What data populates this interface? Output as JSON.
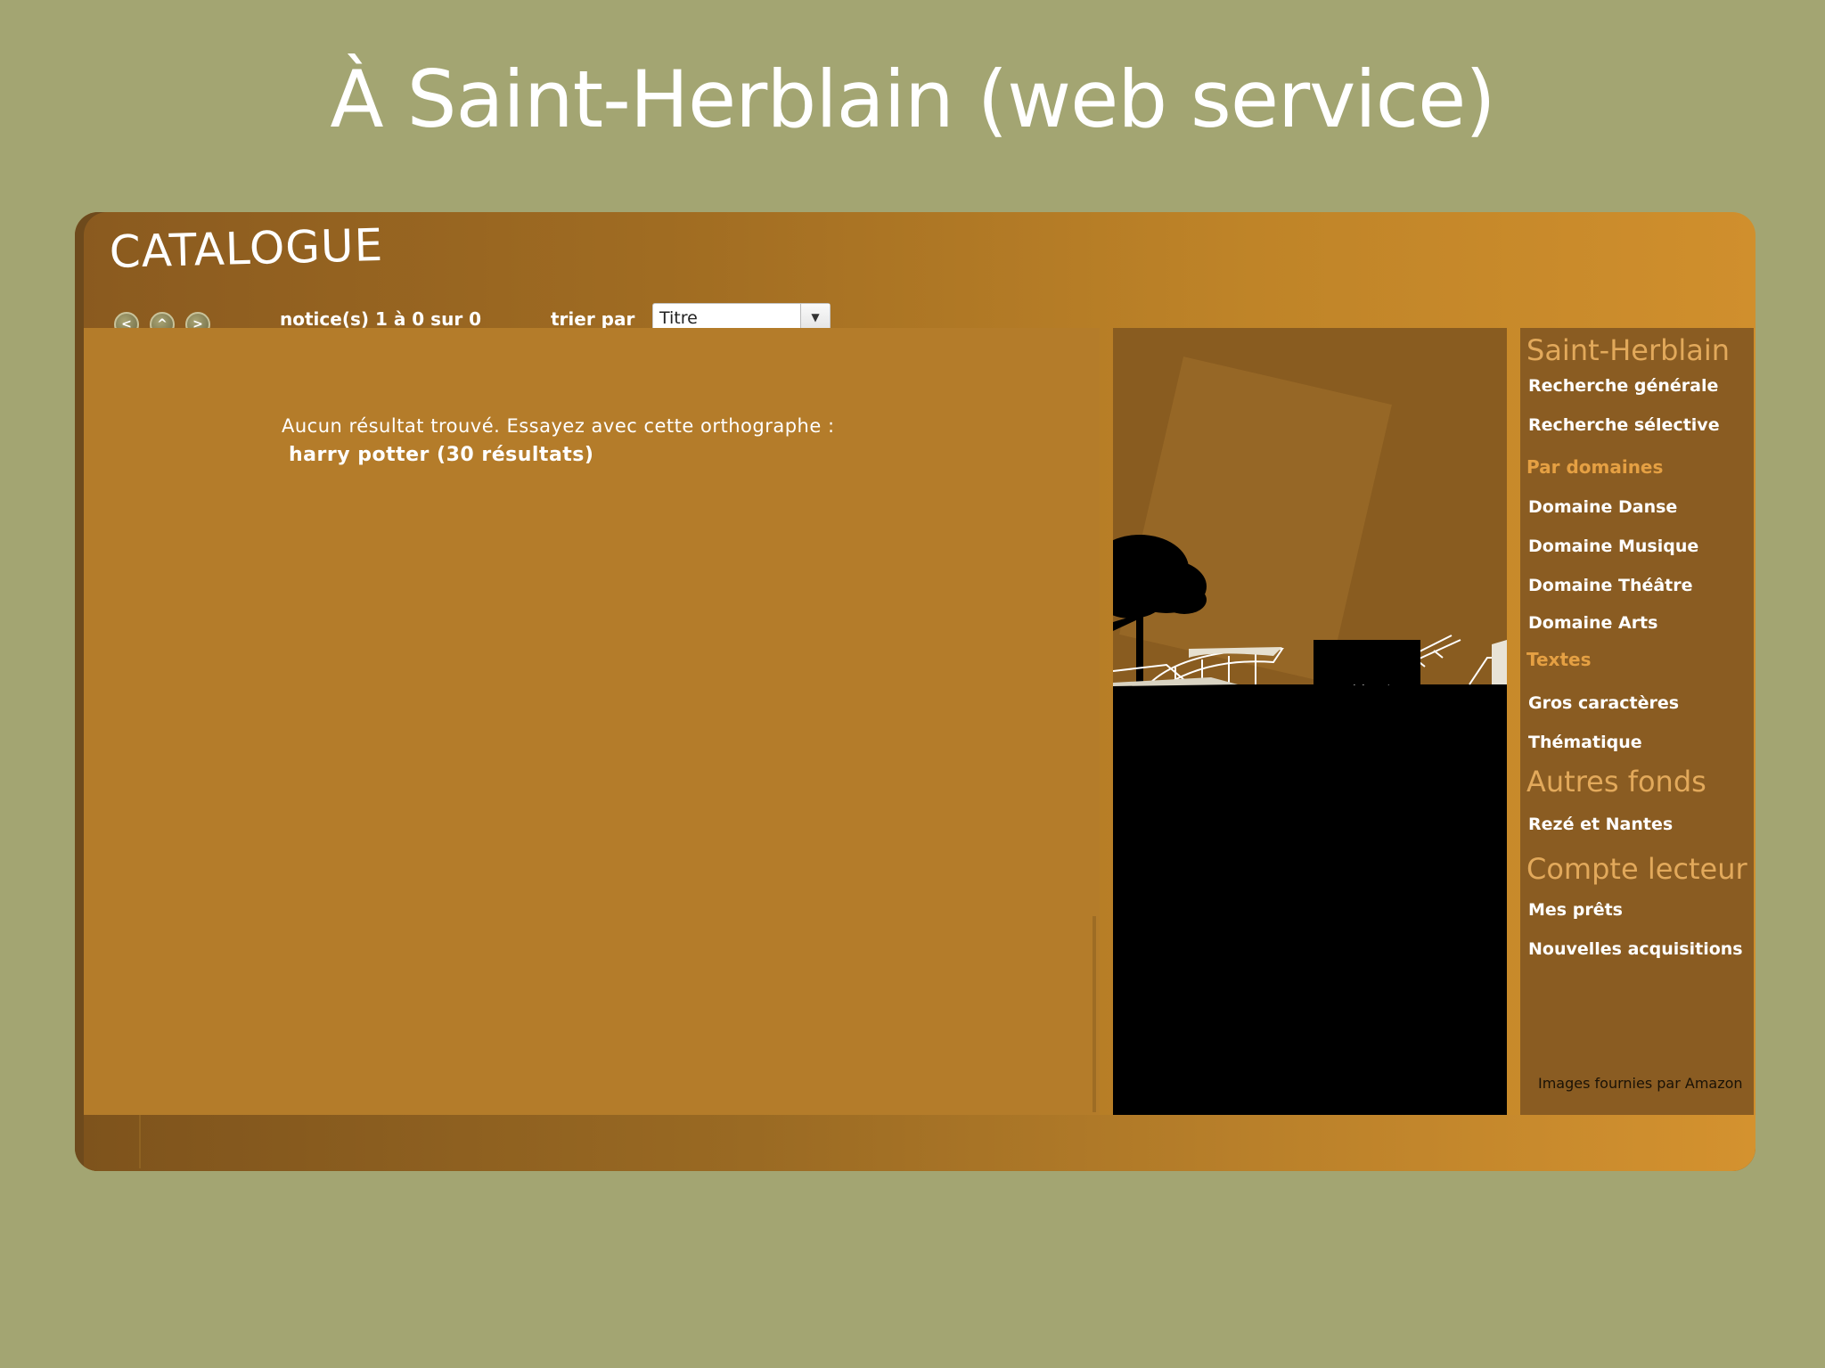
{
  "slide": {
    "title": "À Saint-Herblain (web service)"
  },
  "catalogue": {
    "title": "CATALOGUE",
    "nav": {
      "prev": "<",
      "up": "^",
      "next": ">"
    },
    "notice_text": "notice(s) 1 à 0 sur 0",
    "sort_label": "trier par",
    "sort_value": "Titre",
    "message": "Aucun résultat trouvé. Essayez avec cette orthographe :",
    "suggestion": "harry  potter (30 résultats)"
  },
  "sidebar": {
    "heading": "Saint-Herblain",
    "links_main": [
      "Recherche générale",
      "Recherche sélective"
    ],
    "domains_heading": "Par domaines",
    "domains": [
      "Domaine Danse",
      "Domaine Musique",
      "Domaine Théâtre",
      "Domaine Arts"
    ],
    "texts_heading": "Textes",
    "texts": [
      "Gros caractères",
      "Thématique"
    ],
    "other_heading": "Autres fonds",
    "other": [
      "Rezé et Nantes"
    ],
    "account_heading": "Compte lecteur",
    "account": [
      "Mes prêts",
      "Nouvelles acquisitions"
    ],
    "credit": "Images fournies par Amazon"
  },
  "colors": {
    "background": "#a3a572",
    "frame_dark": "#8a5a1f",
    "frame_light": "#d08f2d",
    "content": "#b47c2a",
    "sidebar": "#8a5c22",
    "sidebar_heading": "#e2a95b"
  }
}
